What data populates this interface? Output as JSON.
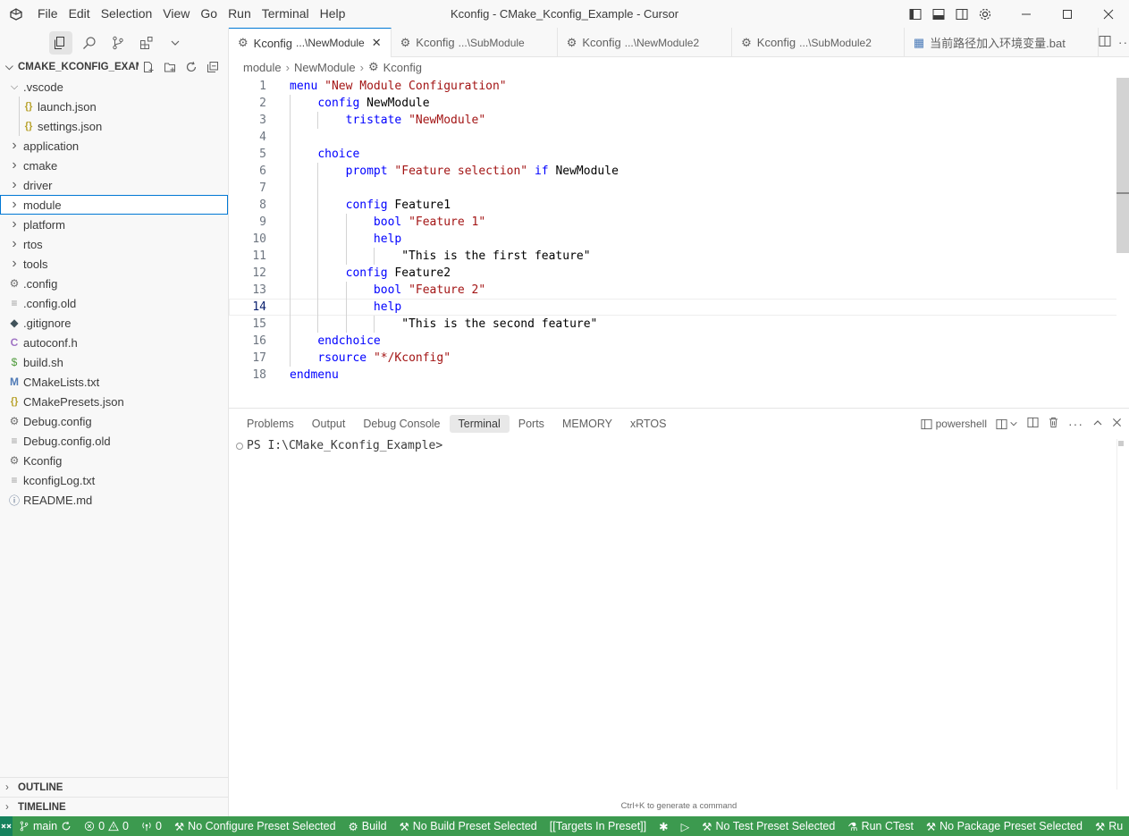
{
  "window": {
    "title": "Kconfig - CMake_Kconfig_Example - Cursor",
    "menu": [
      "File",
      "Edit",
      "Selection",
      "View",
      "Go",
      "Run",
      "Terminal",
      "Help"
    ]
  },
  "sidebar": {
    "header": "CMAKE_KCONFIG_EXAM...",
    "tree": [
      {
        "label": ".vscode",
        "kind": "folder-open",
        "depth": 0
      },
      {
        "label": "launch.json",
        "kind": "json",
        "depth": 1
      },
      {
        "label": "settings.json",
        "kind": "json",
        "depth": 1
      },
      {
        "label": "application",
        "kind": "folder",
        "depth": 0
      },
      {
        "label": "cmake",
        "kind": "folder",
        "depth": 0
      },
      {
        "label": "driver",
        "kind": "folder",
        "depth": 0
      },
      {
        "label": "module",
        "kind": "folder",
        "depth": 0,
        "selected": true
      },
      {
        "label": "platform",
        "kind": "folder",
        "depth": 0
      },
      {
        "label": "rtos",
        "kind": "folder",
        "depth": 0
      },
      {
        "label": "tools",
        "kind": "folder",
        "depth": 0
      },
      {
        "label": ".config",
        "kind": "gear",
        "depth": 0
      },
      {
        "label": ".config.old",
        "kind": "text",
        "depth": 0
      },
      {
        "label": ".gitignore",
        "kind": "git",
        "depth": 0
      },
      {
        "label": "autoconf.h",
        "kind": "c",
        "depth": 0
      },
      {
        "label": "build.sh",
        "kind": "shell",
        "depth": 0
      },
      {
        "label": "CMakeLists.txt",
        "kind": "cmake",
        "depth": 0
      },
      {
        "label": "CMakePresets.json",
        "kind": "json",
        "depth": 0
      },
      {
        "label": "Debug.config",
        "kind": "gear",
        "depth": 0
      },
      {
        "label": "Debug.config.old",
        "kind": "text",
        "depth": 0
      },
      {
        "label": "Kconfig",
        "kind": "gear",
        "depth": 0
      },
      {
        "label": "kconfigLog.txt",
        "kind": "text",
        "depth": 0
      },
      {
        "label": "README.md",
        "kind": "info",
        "depth": 0
      }
    ],
    "outline": "OUTLINE",
    "timeline": "TIMELINE"
  },
  "tabs": [
    {
      "name": "Kconfig",
      "desc": "...\\NewModule",
      "active": true
    },
    {
      "name": "Kconfig",
      "desc": "...\\SubModule",
      "active": false
    },
    {
      "name": "Kconfig",
      "desc": "...\\NewModule2",
      "active": false
    },
    {
      "name": "Kconfig",
      "desc": "...\\SubModule2",
      "active": false
    },
    {
      "name": "当前路径加入环境变量.bat",
      "desc": "",
      "active": false
    }
  ],
  "breadcrumb": [
    "module",
    "NewModule",
    "Kconfig"
  ],
  "code": {
    "current_line": 14,
    "lines": [
      [
        {
          "t": "menu",
          "c": "kw"
        },
        {
          "t": " "
        },
        {
          "t": "\"New Module Configuration\"",
          "c": "str"
        }
      ],
      [
        {
          "t": "    "
        },
        {
          "t": "config",
          "c": "kw"
        },
        {
          "t": " NewModule",
          "c": "plain"
        }
      ],
      [
        {
          "t": "        "
        },
        {
          "t": "tristate",
          "c": "kw"
        },
        {
          "t": " "
        },
        {
          "t": "\"NewModule\"",
          "c": "str"
        }
      ],
      [],
      [
        {
          "t": "    "
        },
        {
          "t": "choice",
          "c": "kw"
        }
      ],
      [
        {
          "t": "        "
        },
        {
          "t": "prompt",
          "c": "kw"
        },
        {
          "t": " "
        },
        {
          "t": "\"Feature selection\"",
          "c": "str"
        },
        {
          "t": " "
        },
        {
          "t": "if",
          "c": "kw"
        },
        {
          "t": " NewModule",
          "c": "plain"
        }
      ],
      [],
      [
        {
          "t": "        "
        },
        {
          "t": "config",
          "c": "kw"
        },
        {
          "t": " Feature1",
          "c": "plain"
        }
      ],
      [
        {
          "t": "            "
        },
        {
          "t": "bool",
          "c": "kw"
        },
        {
          "t": " "
        },
        {
          "t": "\"Feature 1\"",
          "c": "str"
        }
      ],
      [
        {
          "t": "            "
        },
        {
          "t": "help",
          "c": "kw"
        }
      ],
      [
        {
          "t": "                "
        },
        {
          "t": "\"This is the first feature\"",
          "c": "plain"
        }
      ],
      [
        {
          "t": "        "
        },
        {
          "t": "config",
          "c": "kw"
        },
        {
          "t": " Feature2",
          "c": "plain"
        }
      ],
      [
        {
          "t": "            "
        },
        {
          "t": "bool",
          "c": "kw"
        },
        {
          "t": " "
        },
        {
          "t": "\"Feature 2\"",
          "c": "str"
        }
      ],
      [
        {
          "t": "            "
        },
        {
          "t": "help",
          "c": "kw"
        }
      ],
      [
        {
          "t": "                "
        },
        {
          "t": "\"This is the second feature\"",
          "c": "plain"
        }
      ],
      [
        {
          "t": "    "
        },
        {
          "t": "endchoice",
          "c": "kw"
        }
      ],
      [
        {
          "t": "    "
        },
        {
          "t": "rsource",
          "c": "kw"
        },
        {
          "t": " "
        },
        {
          "t": "\"*/Kconfig\"",
          "c": "str"
        }
      ],
      [
        {
          "t": "endmenu",
          "c": "kw"
        }
      ]
    ]
  },
  "panel": {
    "tabs": [
      "Problems",
      "Output",
      "Debug Console",
      "Terminal",
      "Ports",
      "MEMORY",
      "xRTOS"
    ],
    "active_tab": "Terminal",
    "shell": "powershell",
    "prompt": "PS I:\\CMake_Kconfig_Example>",
    "hint": "Ctrl+K to generate a command"
  },
  "statusbar": {
    "branch": "main",
    "errors": "0",
    "warnings": "0",
    "ports": "0",
    "items": [
      "No Configure Preset Selected",
      "Build",
      "No Build Preset Selected",
      "[[Targets In Preset]]",
      "",
      "",
      "No Test Preset Selected",
      "Run CTest",
      "No Package Preset Selected",
      "Ru"
    ]
  },
  "colors": {
    "accent": "#0078d4",
    "statusbar": "#3c9a4f",
    "remote": "#16825d",
    "keyword": "#0000ff",
    "string": "#a31515"
  }
}
